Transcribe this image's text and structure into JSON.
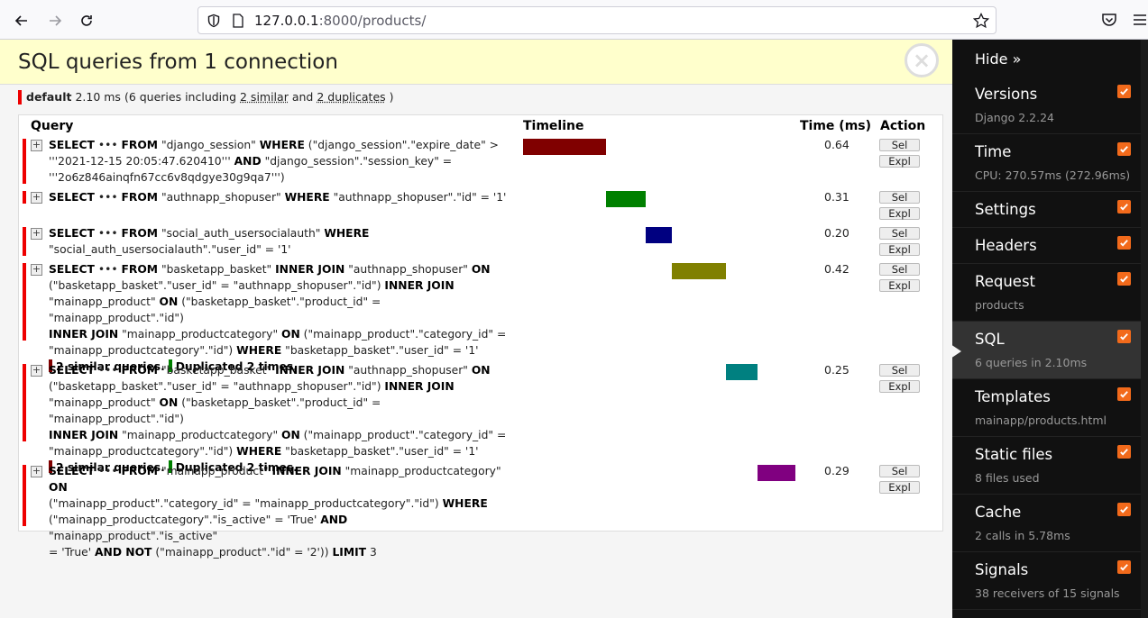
{
  "browser": {
    "url_host": "127.0.0.1",
    "url_rest": ":8000/products/"
  },
  "panel": {
    "title": "SQL queries from 1 connection",
    "close_glyph": "×",
    "summary": {
      "alias": "default",
      "time": "2.10 ms",
      "pre": "(6 queries including",
      "similar": "2 similar",
      "and": "and",
      "duplicates": "2 duplicates",
      "post": ")"
    },
    "columns": {
      "query": "Query",
      "timeline": "Timeline",
      "time": "Time (ms)",
      "action": "Action"
    },
    "sel_label": "Sel",
    "expl_label": "Expl",
    "similar_text": "2 similar queries.",
    "duplicated_text": "Duplicated 2 times.",
    "queries": [
      {
        "time": "0.64",
        "bar_color": "#800000",
        "start": 0,
        "duration": 0.64,
        "lines": [
          "<b>SELECT</b> ••• <b>FROM</b> \"django_session\" <b>WHERE</b> (\"django_session\".\"expire_date\" &gt;",
          "'''2021-12-15 20:05:47.620410''' <b>AND</b> \"django_session\".\"session_key\" =",
          "'''2o6z846ainqfn67cc6v8qdgye30g9qa7''')"
        ]
      },
      {
        "time": "0.31",
        "bar_color": "#008000",
        "start": 0.64,
        "duration": 0.31,
        "lines": [
          "<b>SELECT</b> ••• <b>FROM</b> \"authnapp_shopuser\" <b>WHERE</b> \"authnapp_shopuser\".\"id\" = '1'"
        ]
      },
      {
        "time": "0.20",
        "bar_color": "#000080",
        "start": 0.95,
        "duration": 0.2,
        "lines": [
          "<b>SELECT</b> ••• <b>FROM</b> \"social_auth_usersocialauth\" <b>WHERE</b>",
          "\"social_auth_usersocialauth\".\"user_id\" = '1'"
        ]
      },
      {
        "time": "0.42",
        "bar_color": "#808000",
        "start": 1.15,
        "duration": 0.42,
        "similar": true,
        "lines": [
          "<b>SELECT</b> ••• <b>FROM</b> \"basketapp_basket\" <b>INNER JOIN</b> \"authnapp_shopuser\" <b>ON</b>",
          "(\"basketapp_basket\".\"user_id\" = \"authnapp_shopuser\".\"id\") <b>INNER JOIN</b>",
          "\"mainapp_product\" <b>ON</b> (\"basketapp_basket\".\"product_id\" = \"mainapp_product\".\"id\")",
          "<b>INNER JOIN</b> \"mainapp_productcategory\" <b>ON</b> (\"mainapp_product\".\"category_id\" =",
          "\"mainapp_productcategory\".\"id\") <b>WHERE</b> \"basketapp_basket\".\"user_id\" = '1'"
        ]
      },
      {
        "time": "0.25",
        "bar_color": "#008080",
        "start": 1.57,
        "duration": 0.25,
        "similar": true,
        "lines": [
          "<b>SELECT</b> ••• <b>FROM</b> \"basketapp_basket\" <b>INNER JOIN</b> \"authnapp_shopuser\" <b>ON</b>",
          "(\"basketapp_basket\".\"user_id\" = \"authnapp_shopuser\".\"id\") <b>INNER JOIN</b>",
          "\"mainapp_product\" <b>ON</b> (\"basketapp_basket\".\"product_id\" = \"mainapp_product\".\"id\")",
          "<b>INNER JOIN</b> \"mainapp_productcategory\" <b>ON</b> (\"mainapp_product\".\"category_id\" =",
          "\"mainapp_productcategory\".\"id\") <b>WHERE</b> \"basketapp_basket\".\"user_id\" = '1'"
        ]
      },
      {
        "time": "0.29",
        "bar_color": "#800080",
        "start": 1.82,
        "duration": 0.29,
        "lines": [
          "<b>SELECT</b> ••• <b>FROM</b> \"mainapp_product\" <b>INNER JOIN</b> \"mainapp_productcategory\" <b>ON</b>",
          "(\"mainapp_product\".\"category_id\" = \"mainapp_productcategory\".\"id\") <b>WHERE</b>",
          "(\"mainapp_productcategory\".\"is_active\" = 'True' <b>AND</b> \"mainapp_product\".\"is_active\"",
          "= 'True' <b>AND NOT</b> (\"mainapp_product\".\"id\" = '2')) <b>LIMIT</b> 3"
        ]
      }
    ],
    "timeline_total": 2.11
  },
  "sidebar": {
    "hide_label": "Hide »",
    "items": [
      {
        "title": "Versions",
        "sub": "Django 2.2.24",
        "checked": true
      },
      {
        "title": "Time",
        "sub": "CPU: 270.57ms (272.96ms)",
        "checked": true
      },
      {
        "title": "Settings",
        "sub": "",
        "checked": true
      },
      {
        "title": "Headers",
        "sub": "",
        "checked": true
      },
      {
        "title": "Request",
        "sub": "products",
        "checked": true
      },
      {
        "title": "SQL",
        "sub": "6 queries in 2.10ms",
        "checked": true,
        "active": true
      },
      {
        "title": "Templates",
        "sub": "mainapp/products.html",
        "checked": true
      },
      {
        "title": "Static files",
        "sub": "8 files used",
        "checked": true
      },
      {
        "title": "Cache",
        "sub": "2 calls in 5.78ms",
        "checked": true
      },
      {
        "title": "Signals",
        "sub": "38 receivers of 15 signals",
        "checked": true
      }
    ]
  }
}
